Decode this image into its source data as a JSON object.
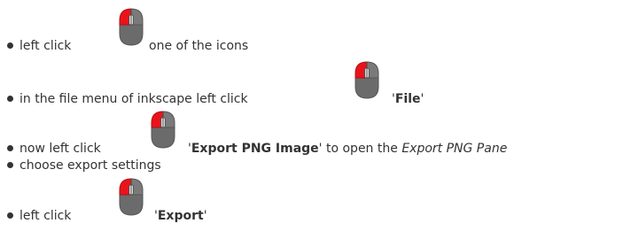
{
  "icons": {
    "mouse": "mouse-left-click-icon",
    "mouse_colors": {
      "left_button": "#e8141c",
      "body": "#6b6b6b",
      "outline": "#5a5a5a"
    }
  },
  "steps": [
    {
      "text": "left click",
      "after": " one of the icons"
    },
    {
      "text": "in the file menu of inkscape left click",
      "quote_open": "'",
      "bold": "File",
      "quote_close": "'"
    },
    {
      "text": "now left click",
      "quote_open": "'",
      "bold": "Export PNG Image",
      "quote_close": "'",
      "after": " to open the ",
      "italic": "Export PNG Pane"
    },
    {
      "text": "choose export settings"
    },
    {
      "text": "left click",
      "quote_open": "'",
      "bold": "Export",
      "quote_close": "'"
    }
  ]
}
